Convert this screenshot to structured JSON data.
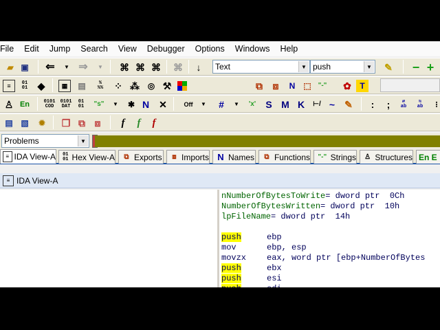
{
  "menu": [
    "File",
    "Edit",
    "Jump",
    "Search",
    "View",
    "Debugger",
    "Options",
    "Windows",
    "Help"
  ],
  "toolbar": {
    "text_combo": "Text",
    "search_combo": "push",
    "icons": {
      "en": "En",
      "cod": "0101\nCOD",
      "dat": "0101\nDAT",
      "b01": "01\n01",
      "quote_s": "\"s\"",
      "n": "N",
      "x": "✕",
      "off": "Off",
      "hash": "#",
      "x_quote": "'x'",
      "s": "S",
      "m": "M",
      "k": "K",
      "tilde": "~",
      "colon": ":",
      "semi": ";",
      "f1": "f",
      "f2": "f",
      "f3": "f",
      "pct": "%",
      "T": "T"
    }
  },
  "problems_combo": "Problems",
  "tabs": [
    "IDA View-A",
    "Hex View-A",
    "Exports",
    "Imports",
    "Names",
    "Functions",
    "Strings",
    "Structures",
    "En E"
  ],
  "subwindow_title": "IDA View-A",
  "code": {
    "var1_name": "nNumberOfBytesToWrite",
    "var1_def": "= dword ptr  0Ch",
    "var2_name": "NumberOfBytesWritten",
    "var2_def": "= dword ptr  10h",
    "var3_name": "lpFileName",
    "var3_def": "= dword ptr  14h",
    "instructions": [
      {
        "mnemonic": "push",
        "operands": "ebp",
        "highlight": true
      },
      {
        "mnemonic": "mov",
        "operands": "ebp, esp",
        "highlight": false
      },
      {
        "mnemonic": "movzx",
        "operands": "eax, word ptr [ebp+NumberOfBytes",
        "highlight": false
      },
      {
        "mnemonic": "push",
        "operands": "ebx",
        "highlight": true
      },
      {
        "mnemonic": "push",
        "operands": "esi",
        "highlight": true
      },
      {
        "mnemonic": "push",
        "operands": "edi",
        "highlight": true
      }
    ]
  },
  "colors": {
    "olive_bar": "#808000",
    "highlight": "#ffff00",
    "var_green": "#006400",
    "tab_accent": "#1a52a6"
  }
}
